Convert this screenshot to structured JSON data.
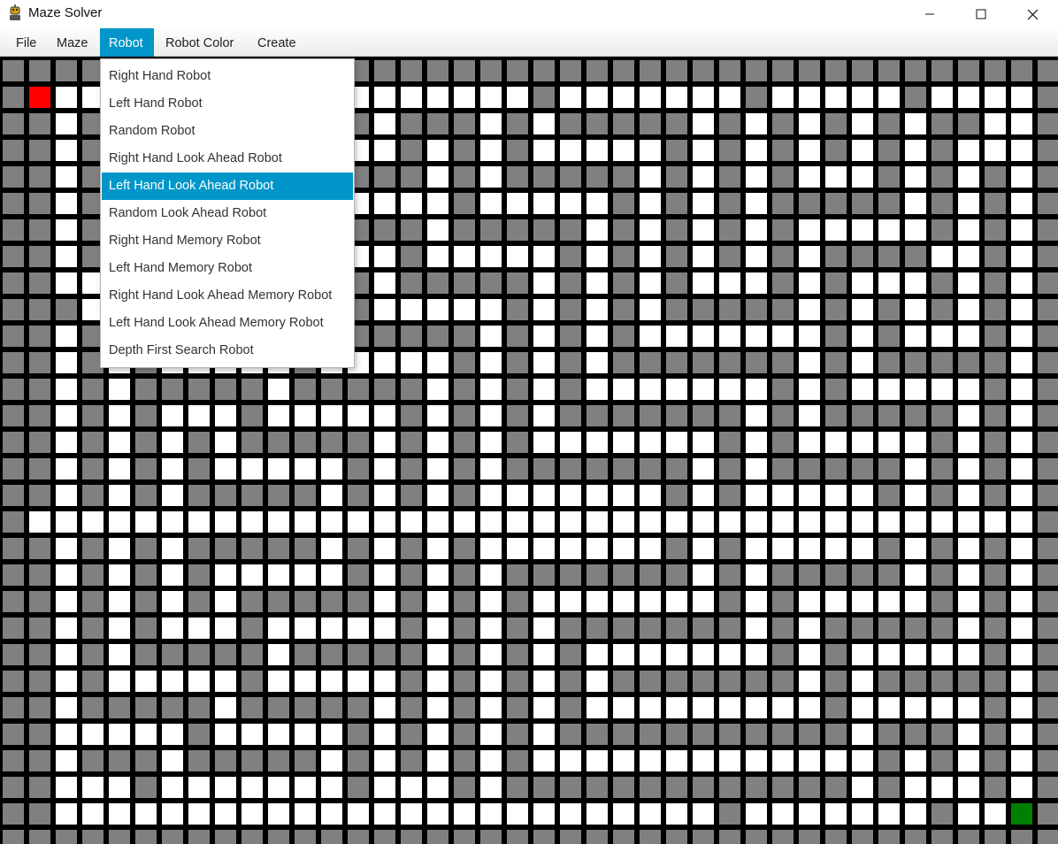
{
  "window": {
    "title": "Maze Solver",
    "icon": "robot-app-icon",
    "controls": [
      "minimize-icon",
      "maximize-icon",
      "close-icon"
    ]
  },
  "menubar": {
    "items": [
      {
        "label": "File"
      },
      {
        "label": "Maze"
      },
      {
        "label": "Robot",
        "active": true
      },
      {
        "label": "Robot Color"
      },
      {
        "label": "Create"
      }
    ]
  },
  "robot_menu": {
    "highlighted_index": 4,
    "items": [
      {
        "label": "Right Hand Robot"
      },
      {
        "label": "Left Hand Robot"
      },
      {
        "label": "Random Robot"
      },
      {
        "label": "Right Hand Look Ahead Robot"
      },
      {
        "label": "Left Hand Look Ahead Robot"
      },
      {
        "label": "Random Look Ahead Robot"
      },
      {
        "label": "Right Hand Memory Robot"
      },
      {
        "label": "Left Hand Memory Robot"
      },
      {
        "label": "Right Hand Look Ahead Memory Robot"
      },
      {
        "label": "Left Hand Look Ahead Memory Robot"
      },
      {
        "label": "Depth First Search Robot"
      }
    ]
  },
  "maze": {
    "columns": 40,
    "rows": 30,
    "colors": {
      "background": "#000000",
      "wall": "#808080",
      "path": "#ffffff",
      "start": "#ff0000",
      "goal": "#008000"
    },
    "start_cell": [
      1,
      1
    ],
    "goal_cell": [
      38,
      28
    ],
    "grid": [
      "########################################",
      "#S..#.......#.......#.......#.....#....#",
      "##.#.#.#.#####.###.#.#####.#.#.#.#.##..#",
      "##.#.#.#.#.....#.#.#.....#.#.#.#.#.#...#",
      "##.#...#.#.#.###.#.#####.#.#.#...#.#.#.#",
      "##.#.###.#.#.....#.....#.#.#.#####.#.#.#",
      "##.#...#.#.#####.#####.#.#.#.#.....#.#.#",
      "##.###.#.#.....#.....#.#.#.#.#.####..#.#",
      "##...#.#.#####.#####.#.#.#...#.#...#.#.#",
      "###.##.#.....#.....#.#.#.#####.#.#.#.#.#",
      "##.#...#####.#####.#.#.#.......#.#...#.#",
      "##.#.#.....#.....#.#.#.#######.#.#####.#",
      "##.#.#####.#####.#.#.#.......#.#.....#.#",
      "##.#.#...#.....#.#.#.#######.#.#####.#.#",
      "##.#.#.#.#####.#.#.#.......#.#.....#.#.#",
      "##.#.#.#.....#.#.#.#######.#.#####.#.#.#",
      "##.#.#.#####.#.#.#.......#.#.....#.#.#.#",
      "#......................................#",
      "##.#.#.#####.#.#.#.......#.#.....#.#.#.#",
      "##.#.#.#.....#.#.#.#######.#.#####.#.#.#",
      "##.#.#.#.#####.#.#.#.......#.#.....#.#.#",
      "##.#.#...#.....#.#.#.#######.#.#####.#.#",
      "##.#.#####.#####.#.#.#.......#.#.....#.#",
      "##.#.....#.....#.#.#.#.#######.#.#####.#",
      "##.#####.#####.#.#.#.#.........#.....#.#",
      "##.....#.....#.#.#.#.###########.###.#.#",
      "##.###.#####.#.#.#.#.............#.#.#.#",
      "##...#.......#...#.#############.#...#.#",
      "##.........................#.......#..G#",
      "########################################"
    ]
  }
}
